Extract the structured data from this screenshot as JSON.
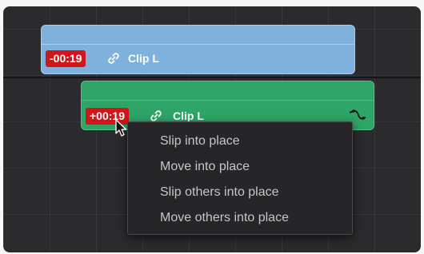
{
  "timeline": {
    "top_clip": {
      "badge": "-00:19",
      "name": "Clip L",
      "link_icon": "link-icon",
      "color": "#7fb1dd"
    },
    "bottom_clip": {
      "badge": "+00:19",
      "name": "Clip L",
      "link_icon": "link-icon",
      "curve_icon": "curve-icon",
      "color": "#2ea566"
    }
  },
  "context_menu": {
    "items": [
      {
        "label": "Slip into place"
      },
      {
        "label": "Move into place"
      },
      {
        "label": "Slip others into place"
      },
      {
        "label": "Move others into place"
      }
    ]
  },
  "colors": {
    "badge_red": "#d0151b",
    "background": "#2b2b2d",
    "menu_bg": "#262629"
  }
}
